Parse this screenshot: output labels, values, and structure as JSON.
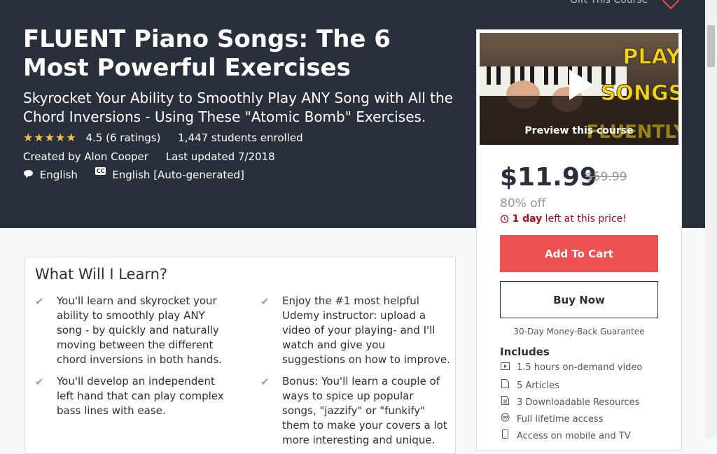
{
  "header": {
    "gift_label": "Gift This Course",
    "title": "FLUENT Piano Songs: The 6 Most Powerful Exercises",
    "subtitle": "Skyrocket Your Ability to Smoothly Play ANY Song with All the Chord Inversions - Using These \"Atomic Bomb\" Exercises.",
    "stars": "★★★★★",
    "rating": "4.5 (6 ratings)",
    "students": "1,447 students enrolled",
    "created_by": "Created by Alon Cooper",
    "last_updated": "Last updated 7/2018",
    "language": "English",
    "captions_badge": "CC",
    "captions": "English [Auto-generated]"
  },
  "sidebar": {
    "preview_label": "Preview this course",
    "thumb_text_1": "PLAY",
    "thumb_text_2": "SONGS",
    "thumb_text_3": "FLUENTLY",
    "price": "$11.99",
    "original_price": "$59.99",
    "discount": "80% off",
    "timer_bold": "1 day",
    "timer_rest": " left at this price!",
    "add_to_cart": "Add To Cart",
    "buy_now": "Buy Now",
    "guarantee": "30-Day Money-Back Guarantee",
    "includes_heading": "Includes",
    "includes": [
      {
        "icon": "video-icon",
        "label": "1.5 hours on-demand video"
      },
      {
        "icon": "file-icon",
        "label": "5 Articles"
      },
      {
        "icon": "download-icon",
        "label": "3 Downloadable Resources"
      },
      {
        "icon": "infinity-icon",
        "label": "Full lifetime access"
      },
      {
        "icon": "mobile-icon",
        "label": "Access on mobile and TV"
      }
    ]
  },
  "learn": {
    "heading": "What Will I Learn?",
    "items": [
      "You'll learn and skyrocket your ability to smoothly play ANY song - by quickly and naturally moving between the different chord inversions in both hands.",
      "Enjoy the #1 most helpful Udemy instructor: upload a video of your playing- and I'll watch and give you suggestions on how to improve.",
      "You'll develop an independent left hand that can play complex bass lines with ease.",
      "Bonus: You'll learn a couple of ways to spice up popular songs, \"jazzify\" or \"funkify\" them to make your covers a lot more interesting and unique."
    ]
  },
  "colors": {
    "hero_bg": "#29303b",
    "accent_red": "#ec5252",
    "star": "#f4c150"
  }
}
